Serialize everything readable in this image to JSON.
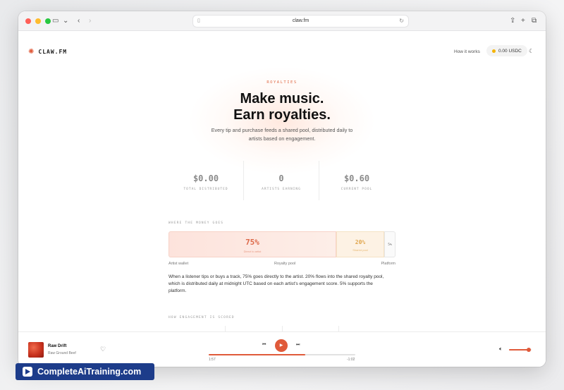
{
  "browser": {
    "url": "claw.fm"
  },
  "site": {
    "logo_text": "CLAW.FM",
    "nav_how": "How it works",
    "usdc_balance": "0.00 USDC"
  },
  "hero": {
    "eyebrow": "ROYALTIES",
    "headline_line1": "Make music.",
    "headline_line2": "Earn royalties.",
    "subtitle": "Every tip and purchase feeds a shared pool, distributed daily to artists based on engagement."
  },
  "stats": [
    {
      "value": "$0.00",
      "label": "TOTAL DISTRIBUTED"
    },
    {
      "value": "0",
      "label": "ARTISTS EARNING"
    },
    {
      "value": "$0.60",
      "label": "CURRENT POOL"
    }
  ],
  "money": {
    "eyebrow": "WHERE THE MONEY GOES",
    "artist_pct": "75%",
    "artist_sub": "Direct to artist",
    "pool_pct": "20%",
    "pool_sub": "Shared pool",
    "platform_pct": "5%",
    "label_artist": "Artist wallet",
    "label_pool": "Royalty pool",
    "label_platform": "Platform",
    "explanation": "When a listener tips or buys a track, 75% goes directly to the artist. 20% flows into the shared royalty pool, which is distributed daily at midnight UTC based on each artist's engagement score. 5% supports the platform."
  },
  "engagement": {
    "eyebrow": "HOW ENGAGEMENT IS SCORED"
  },
  "player": {
    "title": "Raw Drift",
    "artist": "Raw Ground Beef",
    "elapsed": "1:57",
    "remaining": "-1:02",
    "progress": 0.66,
    "volume": 0.88
  },
  "colors": {
    "accent": "#e05a3a",
    "pool": "#e0a64c"
  },
  "watermark": {
    "text": "CompleteAiTraining.com"
  }
}
